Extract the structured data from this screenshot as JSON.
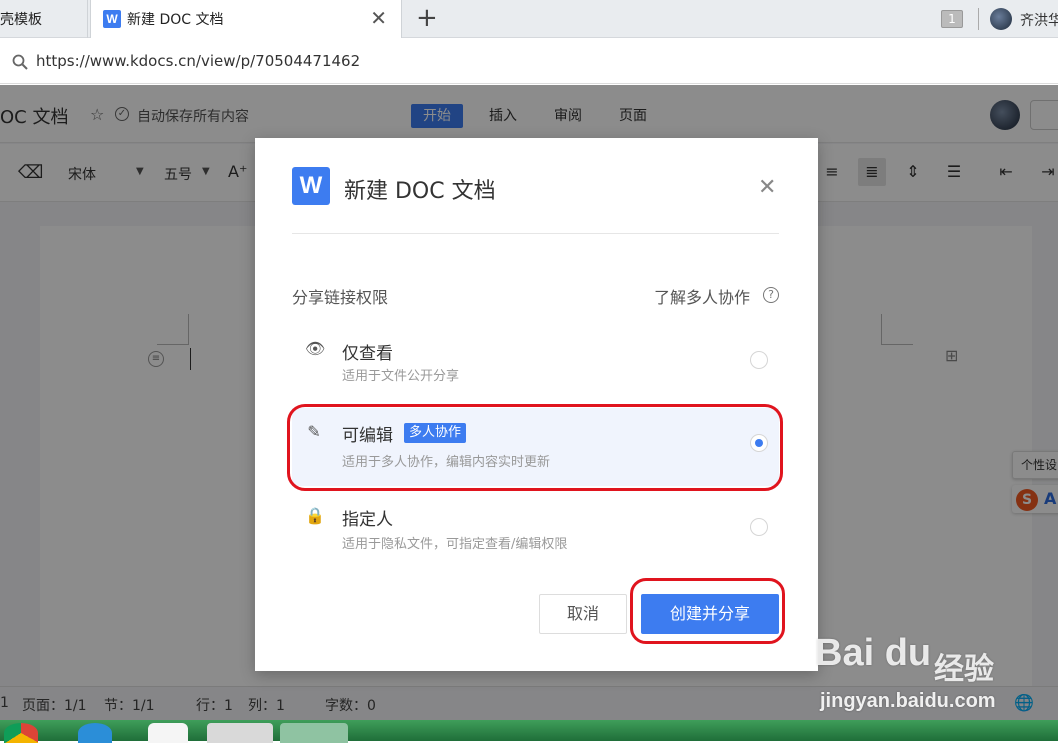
{
  "browser": {
    "inactive_tab": "壳模板",
    "active_tab": "新建 DOC 文档",
    "tab_count": "1",
    "user_name": "齐洪华",
    "url": "https://www.kdocs.cn/view/p/70504471462"
  },
  "app": {
    "doc_title": "OC 文档",
    "autosave": "自动保存所有内容",
    "menu_tabs": [
      "开始",
      "插入",
      "审阅",
      "页面"
    ],
    "toolbar": {
      "font": "宋体",
      "size": "五号"
    }
  },
  "status": {
    "num": "1",
    "page": "页面：1/1",
    "section": "节：1/1",
    "row": "行：1",
    "col": "列：1",
    "words": "字数：0"
  },
  "tooltip": "个性设",
  "modal": {
    "title": "新建 DOC 文档",
    "perm_label": "分享链接权限",
    "learn_link": "了解多人协作",
    "options": [
      {
        "title": "仅查看",
        "desc": "适用于文件公开分享"
      },
      {
        "title": "可编辑",
        "badge": "多人协作",
        "desc": "适用于多人协作，编辑内容实时更新",
        "selected": true
      },
      {
        "title": "指定人",
        "desc": "适用于隐私文件，可指定查看/编辑权限"
      }
    ],
    "cancel": "取消",
    "create": "创建并分享"
  },
  "watermark": {
    "brand": "Bai  du",
    "cn": "经验",
    "url": "jingyan.baidu.com"
  },
  "colors": {
    "accent": "#3d7cf0",
    "annotation": "#e0141e",
    "taskbar": "#2a8547"
  }
}
